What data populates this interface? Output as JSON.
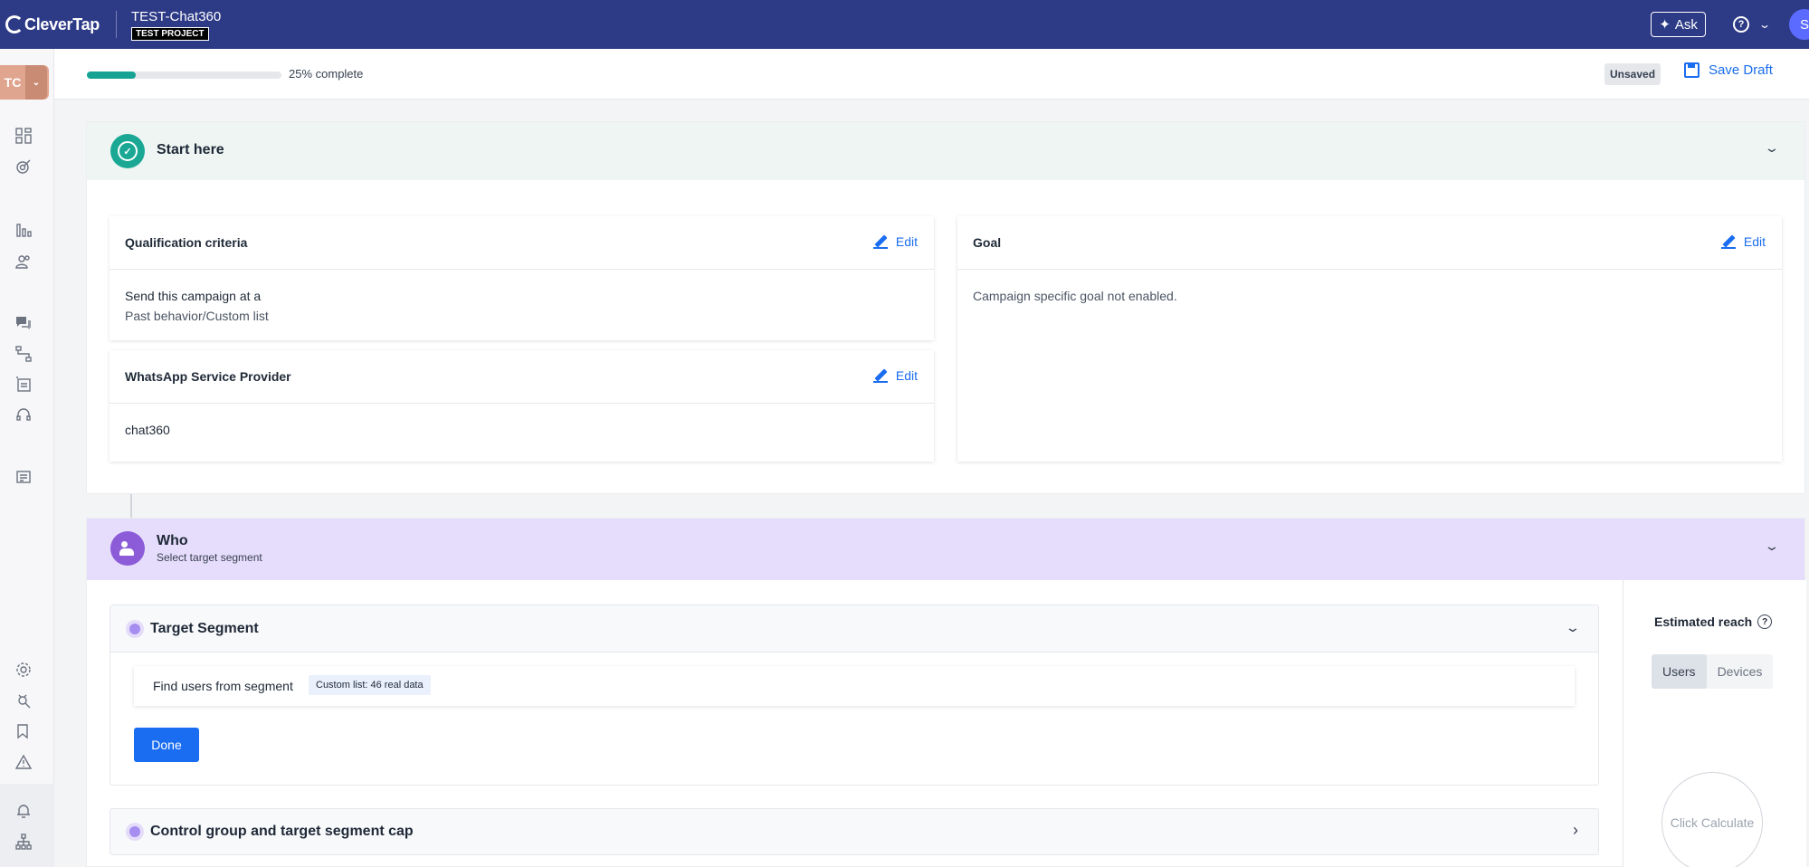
{
  "app": {
    "logo_text": "CleverTap",
    "project_name": "TEST-Chat360",
    "project_badge": "TEST PROJECT"
  },
  "topbar": {
    "ask_label": "Ask",
    "help_symbol": "?",
    "avatar_text": "ST"
  },
  "sidebar": {
    "account_initials": "TC",
    "icons": [
      "dashboard-icon",
      "target-icon",
      "bar-chart-icon",
      "users-icon",
      "chat-icon",
      "journey-icon",
      "catalog-icon",
      "support-icon",
      "report-icon",
      "settings-icon",
      "debug-icon",
      "bookmark-icon",
      "warning-icon",
      "bell-icon",
      "sitemap-icon"
    ]
  },
  "progress": {
    "percent": 25,
    "label": "25% complete",
    "fill_color": "#16a394"
  },
  "status": {
    "unsaved_label": "Unsaved",
    "save_draft_label": "Save Draft"
  },
  "start_section": {
    "title": "Start here",
    "qualification": {
      "title": "Qualification criteria",
      "edit_label": "Edit",
      "line1": "Send this campaign at a",
      "line2": "Past behavior/Custom list"
    },
    "provider": {
      "title": "WhatsApp Service Provider",
      "edit_label": "Edit",
      "value": "chat360"
    },
    "goal": {
      "title": "Goal",
      "edit_label": "Edit",
      "text": "Campaign specific goal not enabled."
    }
  },
  "who_section": {
    "title": "Who",
    "subtitle": "Select target segment",
    "target_segment": {
      "title": "Target Segment",
      "find_label": "Find users from segment",
      "tag": "Custom list: 46 real data",
      "done_label": "Done"
    },
    "control_group": {
      "title": "Control group and target segment cap"
    },
    "reach": {
      "title": "Estimated reach",
      "toggle": [
        "Users",
        "Devices"
      ],
      "selected": "Users",
      "calculate_label": "Click Calculate"
    }
  },
  "colors": {
    "topbar": "#2d3a86",
    "accent_blue": "#1a6df0",
    "start_badge": "#1aa895",
    "who_badge": "#8b5bd8",
    "who_header": "#e6dcfb"
  }
}
